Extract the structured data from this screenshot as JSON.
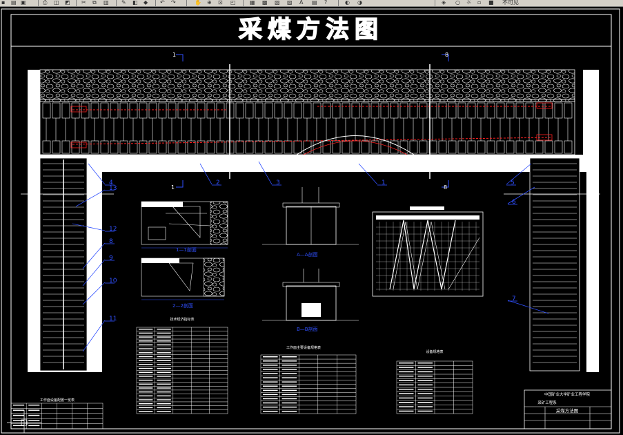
{
  "toolbar": {
    "label_text": "不可见"
  },
  "drawing": {
    "title": "采煤方法图",
    "colors": {
      "background": "#000000",
      "line": "#ffffff",
      "annotation": "#3050ff",
      "highlight": "#ff2020"
    },
    "callouts": [
      "1",
      "2",
      "3",
      "4",
      "5",
      "6",
      "7",
      "8",
      "9",
      "10",
      "11",
      "12",
      "13"
    ],
    "section_marks": [
      "1",
      "1",
      "8",
      "8"
    ],
    "section_labels": {
      "section_1_1": "1—1剖面",
      "section_2_2": "2—2剖面",
      "section_a_a": "A—A剖面",
      "section_b_b": "B—B剖面"
    },
    "tables": {
      "workface_equipment": "工作面设备配置一览表",
      "tech_economic": "技术经济指标表",
      "haulage_equipment": "工作面主要设备规格表",
      "equipment_specs": "设备规格表"
    },
    "title_block": {
      "institution": "中国矿业大学矿业工程学院",
      "department": "采矿工程系",
      "drawing_name": "采煤方法图"
    }
  }
}
